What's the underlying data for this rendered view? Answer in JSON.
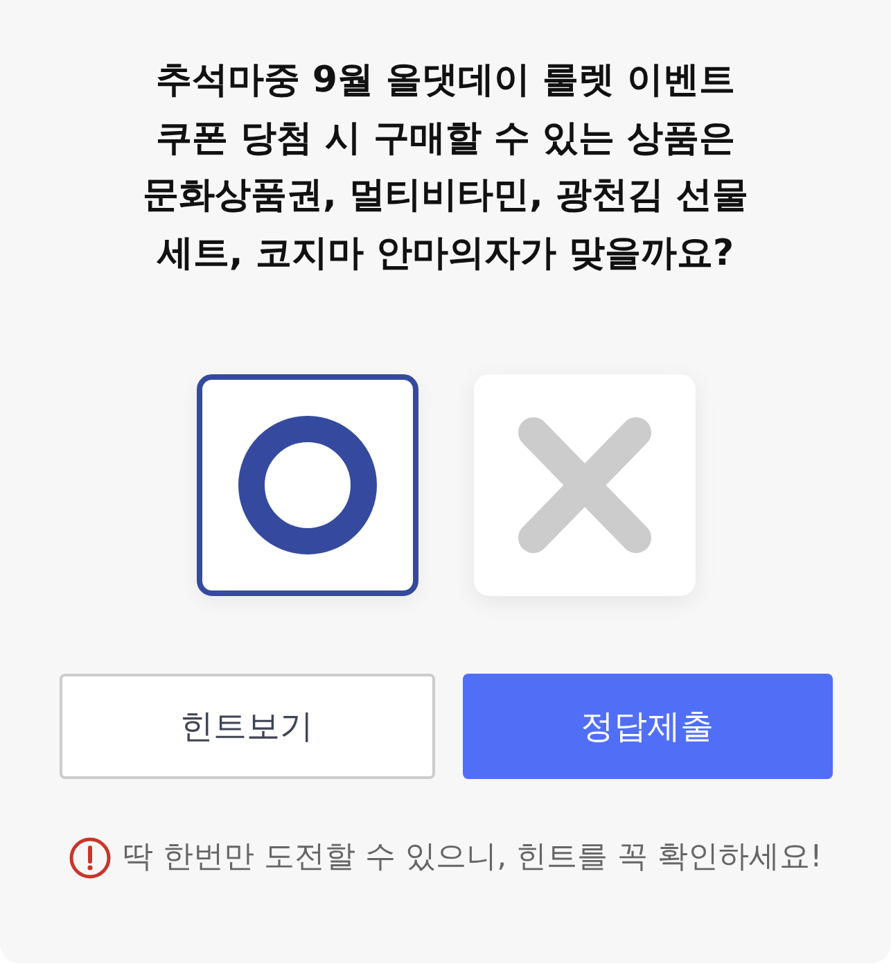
{
  "question": "추석마중 9월 올댓데이 룰렛 이벤트\n쿠폰 당첨 시 구매할 수 있는 상품은\n문화상품권, 멀티비타민, 광천김 선물\n세트, 코지마 안마의자가 맞을까요?",
  "choices": [
    {
      "kind": "circle",
      "selected": true
    },
    {
      "kind": "cross",
      "selected": false
    }
  ],
  "buttons": [
    {
      "kind": "secondary",
      "label": "힌트보기"
    },
    {
      "kind": "primary",
      "label": "정답제출"
    }
  ],
  "notice": {
    "text": "딱 한번만 도전할 수 있으니, 힌트를 꼭 확인하세요!"
  }
}
